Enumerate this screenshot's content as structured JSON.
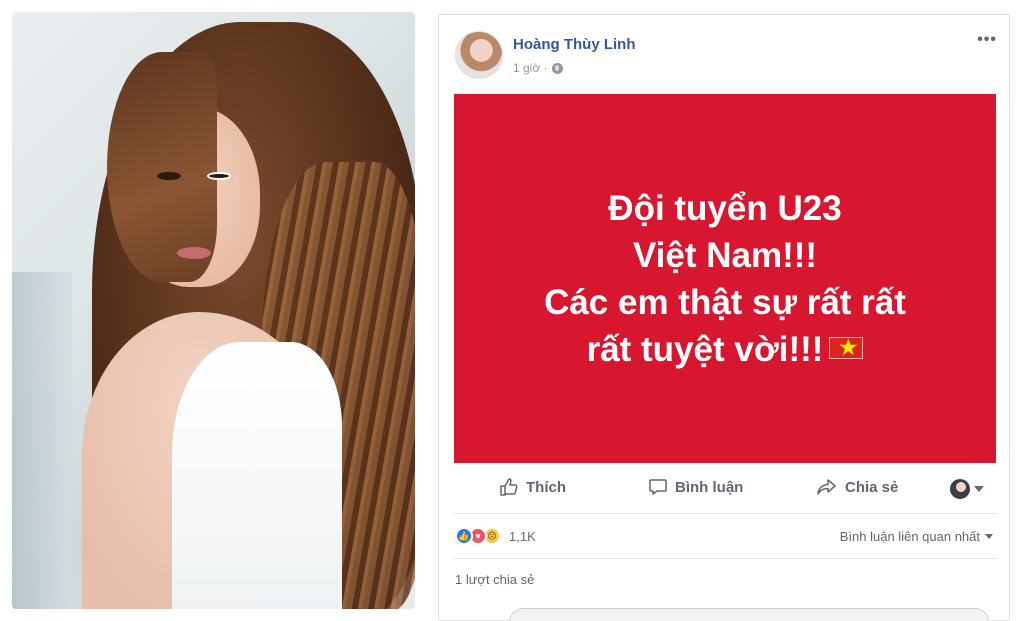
{
  "post": {
    "author": "Hoàng Thùy Linh",
    "time": "1 giờ ·",
    "more": "•••",
    "banner_lines": [
      "Đội tuyển U23",
      "Việt Nam!!!",
      "Các em thật sự rất rất",
      "rất tuyệt vời!!!"
    ]
  },
  "actions": {
    "like": "Thích",
    "comment": "Bình luận",
    "share": "Chia sẻ"
  },
  "stats": {
    "reactions_count": "1,1K",
    "sort_label": "Bình luận liên quan nhất",
    "shares": "1 lượt chia sẻ"
  },
  "icons": {
    "like": "thumbs-up-icon",
    "comment": "speech-bubble-icon",
    "share": "share-arrow-icon",
    "privacy": "globe-icon",
    "flag": "vietnam-flag-icon"
  },
  "colors": {
    "banner": "#d7162f",
    "author": "#365899",
    "muted": "#616770"
  }
}
